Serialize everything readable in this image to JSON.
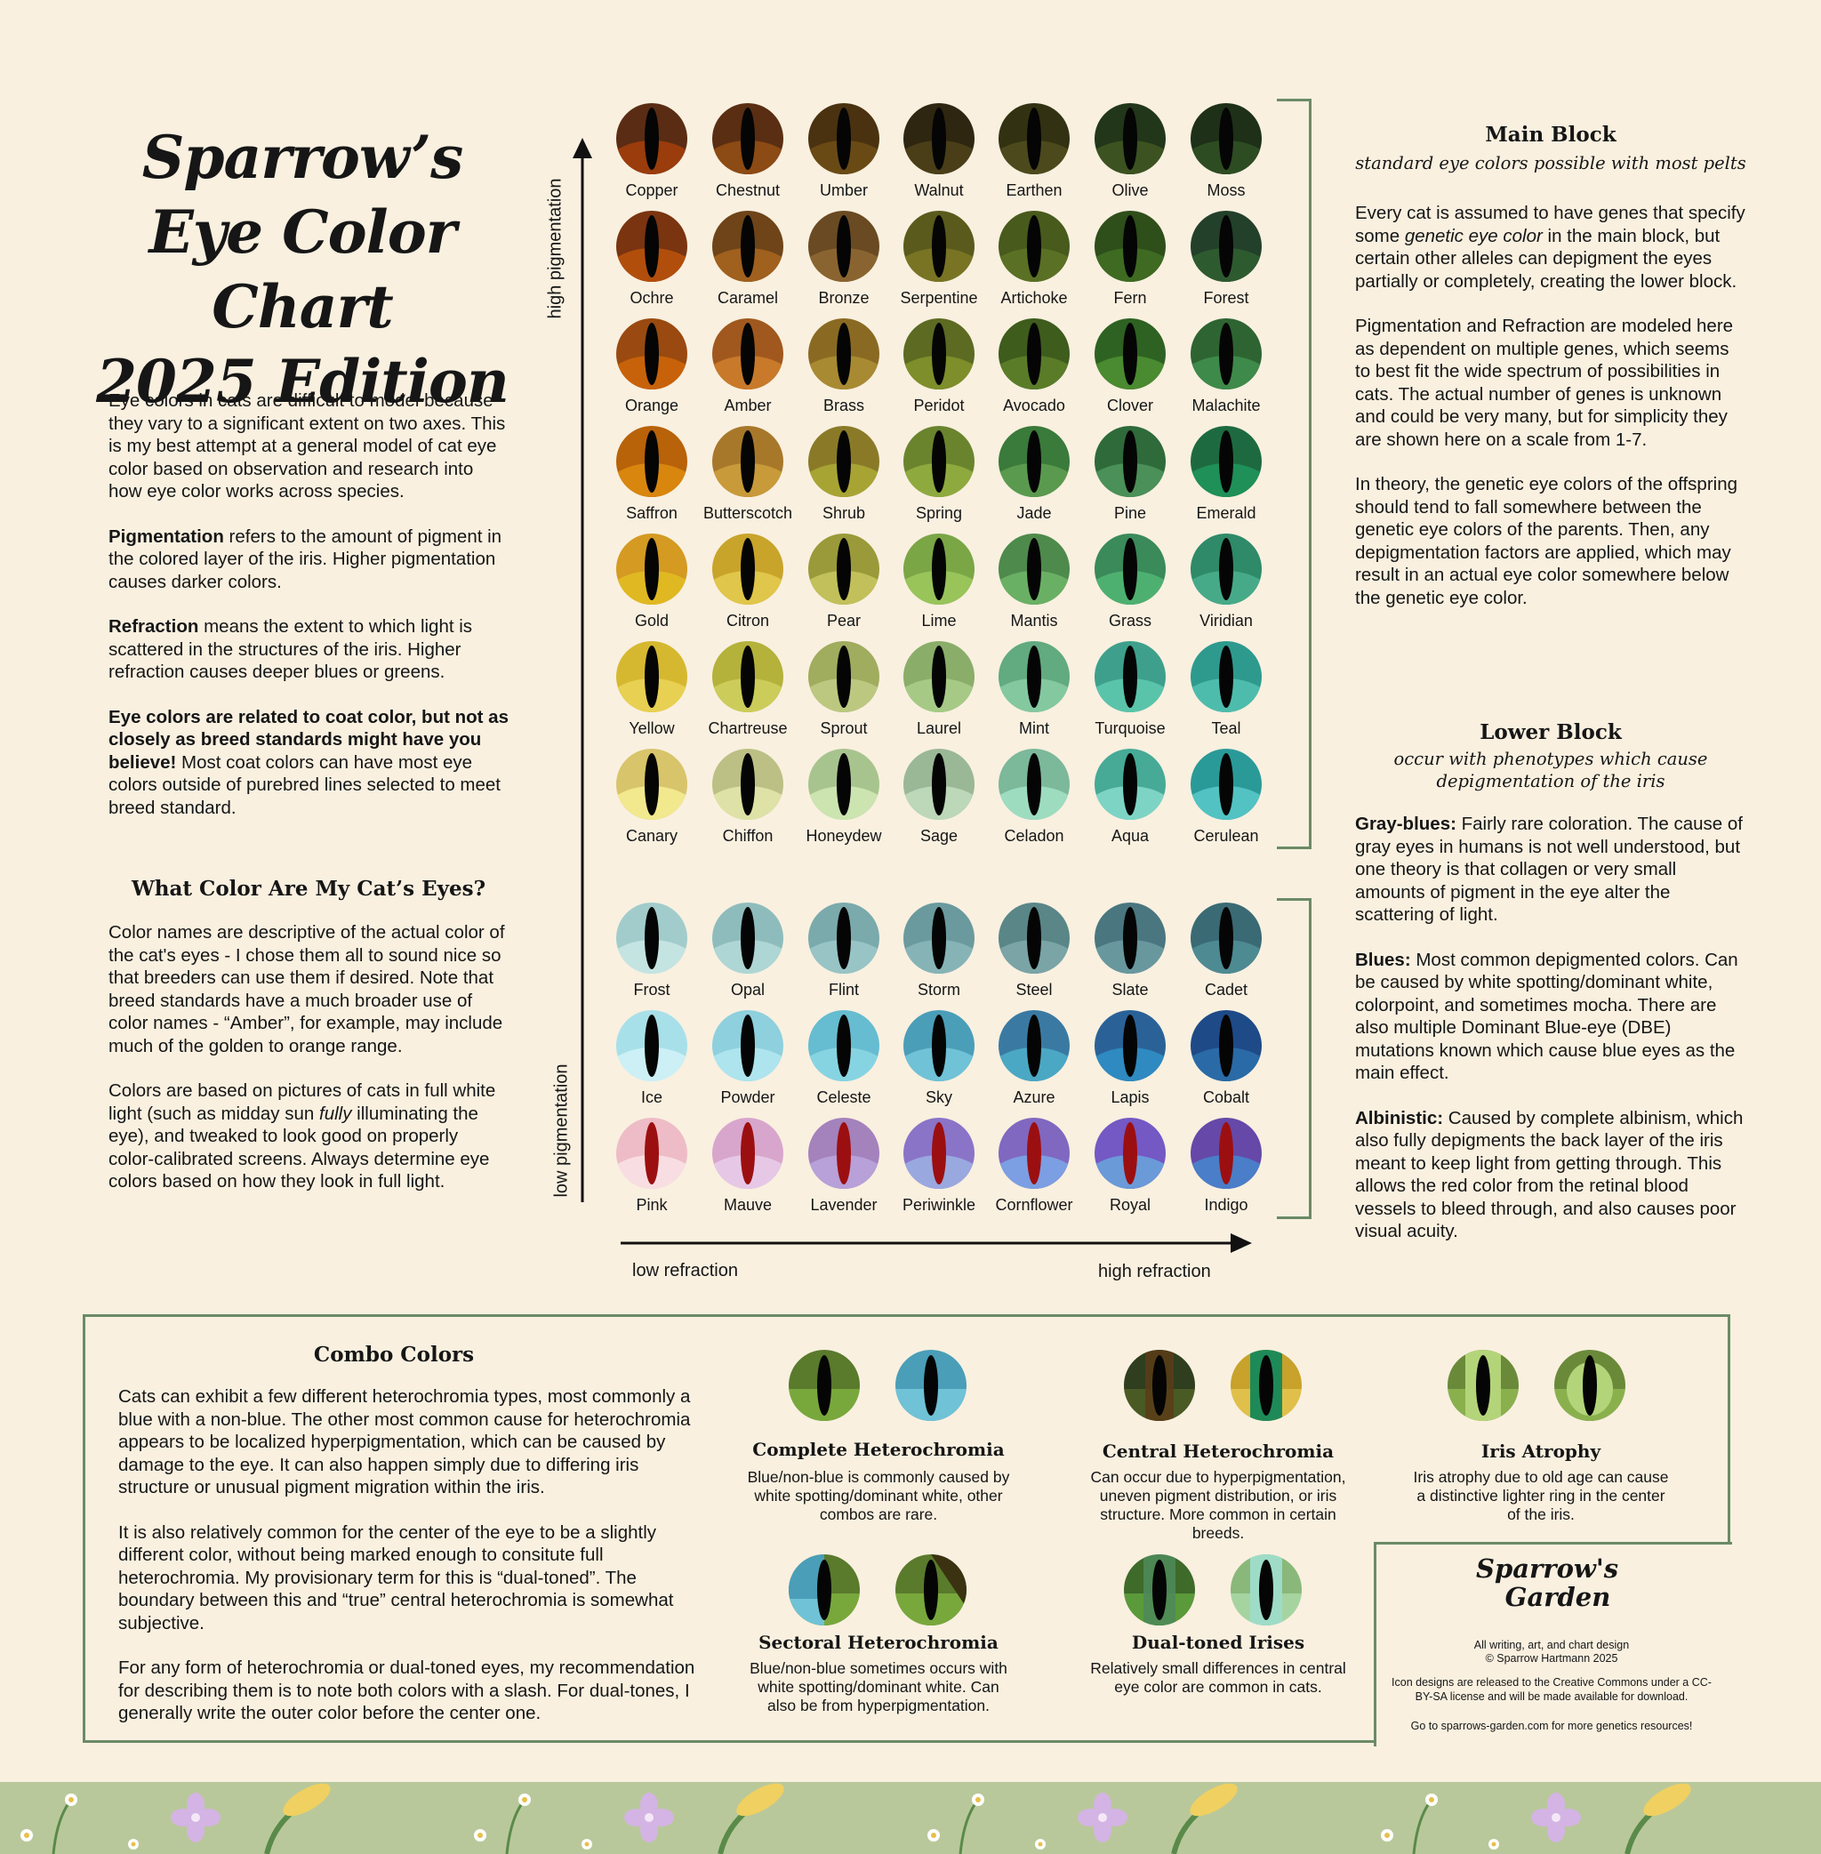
{
  "title": {
    "line1": "Sparrow’s",
    "line2": "Eye Color Chart",
    "line3": "2025 Edition"
  },
  "left_intro": [
    {
      "bold": "",
      "text": "Eye colors in cats are difficult to model because they vary to a significant extent on two axes. This is my best attempt at a general model of cat eye color based on observation and research into how eye color works across species."
    },
    {
      "bold": "Pigmentation",
      "text": " refers to the amount of pigment in the colored layer of the iris. Higher pigmentation causes darker colors."
    },
    {
      "bold": "Refraction",
      "text": " means the extent to which light is scattered in the structures of the iris. Higher refraction causes deeper blues or greens."
    },
    {
      "bold": "Eye colors are related to coat color, but not as closely as breed standards might have you believe!",
      "text": " Most coat colors can have most eye colors outside of purebred lines selected to meet breed standard."
    }
  ],
  "what_color": {
    "heading": "What Color Are My Cat’s Eyes?",
    "p1": "Color names are descriptive of the actual color of the cat's eyes - I chose them all to sound nice so that breeders can use them if desired. Note that breed standards have a much broader use of color names - “Amber”, for example, may include much of the golden to orange range.",
    "p2_a": "Colors are based on pictures of cats in full white light (such as midday sun ",
    "p2_em": "fully",
    "p2_b": " illuminating the eye), and tweaked to look good on properly color-calibrated screens. Always determine eye colors based on how they look in full light."
  },
  "axes": {
    "high_pigmentation": "high pigmentation",
    "low_pigmentation": "low pigmentation",
    "low_refraction": "low refraction",
    "high_refraction": "high refraction"
  },
  "main_block": {
    "heading": "Main Block",
    "subheading": "standard eye colors possible with most pelts",
    "p1_a": "Every cat is assumed to have genes that specify some ",
    "p1_em": "genetic eye color",
    "p1_b": " in the main block, but certain other alleles can depigment the eyes partially or completely, creating the lower block.",
    "p2": "Pigmentation and Refraction are modeled here as dependent on multiple genes, which seems to best fit the wide spectrum of possibilities in cats. The actual number of genes is unknown and could be very many, but for simplicity they are shown here on a scale from 1-7.",
    "p3": "In theory, the genetic eye colors of the offspring should tend to fall somewhere between the genetic eye colors of the parents. Then, any depigmentation factors are applied, which may result in an actual eye color somewhere below the genetic eye color."
  },
  "lower_block": {
    "heading": "Lower Block",
    "subheading": "occur with phenotypes which cause depigmentation of the iris",
    "items": [
      {
        "bold": "Gray-blues:",
        "text": " Fairly rare coloration. The cause of gray eyes in humans is not well understood, but one theory is that collagen or very small amounts of pigment in the eye alter the scattering of light."
      },
      {
        "bold": "Blues:",
        "text": " Most common depigmented colors. Can be caused by white spotting/dominant white, colorpoint, and sometimes mocha. There are also multiple Dominant Blue-eye (DBE) mutations known which cause blue eyes as the main effect."
      },
      {
        "bold": "Albinistic:",
        "text": " Caused by complete albinism, which also fully depigments the back layer of the iris meant to keep light from getting through. This allows the red color from the retinal blood vessels to bleed through, and also causes poor visual acuity."
      }
    ]
  },
  "eyes_main": [
    [
      {
        "name": "Copper",
        "top": "#5a2c14",
        "bottom": "#9a3c0c"
      },
      {
        "name": "Chestnut",
        "top": "#5a2e12",
        "bottom": "#8c4a14"
      },
      {
        "name": "Umber",
        "top": "#4a3210",
        "bottom": "#6a4a14"
      },
      {
        "name": "Walnut",
        "top": "#2e2610",
        "bottom": "#4a3e18"
      },
      {
        "name": "Earthen",
        "top": "#323212",
        "bottom": "#4c4a1c"
      },
      {
        "name": "Olive",
        "top": "#22361a",
        "bottom": "#3c5220"
      },
      {
        "name": "Moss",
        "top": "#1e3018",
        "bottom": "#2e4c22"
      }
    ],
    [
      {
        "name": "Ochre",
        "top": "#7a3410",
        "bottom": "#b24e0c"
      },
      {
        "name": "Caramel",
        "top": "#6e4418",
        "bottom": "#a0601e"
      },
      {
        "name": "Bronze",
        "top": "#6a4a22",
        "bottom": "#8a6430"
      },
      {
        "name": "Serpentine",
        "top": "#5a5a1c",
        "bottom": "#787424"
      },
      {
        "name": "Artichoke",
        "top": "#485a1c",
        "bottom": "#5a7024"
      },
      {
        "name": "Fern",
        "top": "#2e4e1a",
        "bottom": "#3e6a22"
      },
      {
        "name": "Forest",
        "top": "#23402a",
        "bottom": "#2e5a30"
      }
    ],
    [
      {
        "name": "Orange",
        "top": "#9a4a10",
        "bottom": "#c8620a"
      },
      {
        "name": "Amber",
        "top": "#a0581e",
        "bottom": "#c87a2a"
      },
      {
        "name": "Brass",
        "top": "#8a6a22",
        "bottom": "#a88a32"
      },
      {
        "name": "Peridot",
        "top": "#5c6a22",
        "bottom": "#7e8e2a"
      },
      {
        "name": "Avocado",
        "top": "#3e5c1c",
        "bottom": "#5a7c28"
      },
      {
        "name": "Clover",
        "top": "#2e6222",
        "bottom": "#4a8a30"
      },
      {
        "name": "Malachite",
        "top": "#2e6432",
        "bottom": "#3e8a4a"
      }
    ],
    [
      {
        "name": "Saffron",
        "top": "#b8620a",
        "bottom": "#d8860e"
      },
      {
        "name": "Butterscotch",
        "top": "#a8782a",
        "bottom": "#c89a3a"
      },
      {
        "name": "Shrub",
        "top": "#8a7a28",
        "bottom": "#a8a434"
      },
      {
        "name": "Spring",
        "top": "#6a842e",
        "bottom": "#8eaa3e"
      },
      {
        "name": "Jade",
        "top": "#3a7a3a",
        "bottom": "#5a9a4e"
      },
      {
        "name": "Pine",
        "top": "#2e6a3a",
        "bottom": "#4a9058"
      },
      {
        "name": "Emerald",
        "top": "#1e6a40",
        "bottom": "#1e9058"
      }
    ],
    [
      {
        "name": "Gold",
        "top": "#d49a22",
        "bottom": "#e0b822"
      },
      {
        "name": "Citron",
        "top": "#c8a42a",
        "bottom": "#e0c64a"
      },
      {
        "name": "Pear",
        "top": "#9a9a3a",
        "bottom": "#c2c05a"
      },
      {
        "name": "Lime",
        "top": "#7aa646",
        "bottom": "#98c45a"
      },
      {
        "name": "Mantis",
        "top": "#4e8a4c",
        "bottom": "#6ab064"
      },
      {
        "name": "Grass",
        "top": "#3a8a5a",
        "bottom": "#4eb070"
      },
      {
        "name": "Viridian",
        "top": "#2e8a68",
        "bottom": "#46aa88"
      }
    ],
    [
      {
        "name": "Yellow",
        "top": "#d6b830",
        "bottom": "#e8d052"
      },
      {
        "name": "Chartreuse",
        "top": "#b4b23a",
        "bottom": "#cccc5a"
      },
      {
        "name": "Sprout",
        "top": "#a0ac5e",
        "bottom": "#bcc880"
      },
      {
        "name": "Laurel",
        "top": "#8aae6a",
        "bottom": "#a6ca86"
      },
      {
        "name": "Mint",
        "top": "#62aa80",
        "bottom": "#84c8a0"
      },
      {
        "name": "Turquoise",
        "top": "#3ea08c",
        "bottom": "#5ac4aa"
      },
      {
        "name": "Teal",
        "top": "#2e9a8e",
        "bottom": "#4ebcac"
      }
    ],
    [
      {
        "name": "Canary",
        "top": "#d8c46a",
        "bottom": "#f2e88e"
      },
      {
        "name": "Chiffon",
        "top": "#bcc084",
        "bottom": "#dee2a6"
      },
      {
        "name": "Honeydew",
        "top": "#a8c48e",
        "bottom": "#cce4b0"
      },
      {
        "name": "Sage",
        "top": "#9ab896",
        "bottom": "#bcd8b8"
      },
      {
        "name": "Celadon",
        "top": "#7cb89a",
        "bottom": "#9edcc0"
      },
      {
        "name": "Aqua",
        "top": "#46aa96",
        "bottom": "#7ed4c4"
      },
      {
        "name": "Cerulean",
        "top": "#2a9a98",
        "bottom": "#52c2c2"
      }
    ]
  ],
  "eyes_lower": [
    [
      {
        "name": "Frost",
        "top": "#a2cccc",
        "bottom": "#c4e4e2"
      },
      {
        "name": "Opal",
        "top": "#8ebcbc",
        "bottom": "#aed6d4"
      },
      {
        "name": "Flint",
        "top": "#7aaaac",
        "bottom": "#98c4c6"
      },
      {
        "name": "Storm",
        "top": "#6a9a9e",
        "bottom": "#86b4b6"
      },
      {
        "name": "Steel",
        "top": "#5a8688",
        "bottom": "#7aa4a6"
      },
      {
        "name": "Slate",
        "top": "#4a7680",
        "bottom": "#68989e"
      },
      {
        "name": "Cadet",
        "top": "#3a6a74",
        "bottom": "#4e8a92"
      }
    ],
    [
      {
        "name": "Ice",
        "top": "#a8e0ea",
        "bottom": "#ccf0f6"
      },
      {
        "name": "Powder",
        "top": "#8ed0de",
        "bottom": "#aee4ee"
      },
      {
        "name": "Celeste",
        "top": "#66bcd0",
        "bottom": "#86d4e2"
      },
      {
        "name": "Sky",
        "top": "#4a9eb8",
        "bottom": "#70c2d6"
      },
      {
        "name": "Azure",
        "top": "#3a7aa2",
        "bottom": "#4aa8c4"
      },
      {
        "name": "Lapis",
        "top": "#2a6298",
        "bottom": "#2e8ac0"
      },
      {
        "name": "Cobalt",
        "top": "#1e4a88",
        "bottom": "#2a6aa6"
      }
    ],
    [
      {
        "name": "Pink",
        "top": "#eebcc6",
        "bottom": "#f8dee2"
      },
      {
        "name": "Mauve",
        "top": "#d8a6cc",
        "bottom": "#e6c8e6"
      },
      {
        "name": "Lavender",
        "top": "#a482bc",
        "bottom": "#b8a0d8"
      },
      {
        "name": "Periwinkle",
        "top": "#8a74c8",
        "bottom": "#9aa8e0"
      },
      {
        "name": "Cornflower",
        "top": "#8068c0",
        "bottom": "#7c9ee2"
      },
      {
        "name": "Royal",
        "top": "#7458c4",
        "bottom": "#6a9ad8"
      },
      {
        "name": "Indigo",
        "top": "#6648a8",
        "bottom": "#4a7ec8"
      }
    ]
  ],
  "pupil_colors": {
    "normal": "#050505",
    "albino": "#9c0f10"
  },
  "combo": {
    "heading": "Combo Colors",
    "p1": "Cats can exhibit a few different heterochromia types, most commonly a blue with a non-blue. The other most common cause for heterochromia appears to be localized hyperpigmentation, which can be caused by damage to the eye. It can also happen simply due to differing iris structure or unusual pigment migration within the iris.",
    "p2": "It is also relatively common for the center of the eye to be a slightly different color, without being marked enough to consitute full heterochromia. My provisionary term for this is “dual-toned”. The boundary between this and “true” central heterochromia is somewhat subjective.",
    "p3": "For any form of heterochromia or dual-toned eyes, my recommendation for describing them is to note both colors with a slash. For dual-tones, I generally write the outer color before the center one.",
    "types": [
      {
        "title": "Complete Heterochromia",
        "desc": "Blue/non-blue is commonly caused by white spotting/dominant white, other combos are rare."
      },
      {
        "title": "Central Heterochromia",
        "desc": "Can occur due to hyperpigmentation, uneven pigment distribution, or iris structure. More common in certain breeds."
      },
      {
        "title": "Iris Atrophy",
        "desc": "Iris atrophy due to old age can cause a distinctive lighter ring in the center of the iris."
      },
      {
        "title": "Sectoral Heterochromia",
        "desc": "Blue/non-blue sometimes occurs with white spotting/dominant white. Can also be from hyperpigmentation."
      },
      {
        "title": "Dual-toned Irises",
        "desc": "Relatively small differences in central eye color are common in cats."
      }
    ]
  },
  "credits": {
    "logo_line1": "Sparrow's",
    "logo_line2": "Garden",
    "line1": "All writing, art, and chart design",
    "line2": "© Sparrow Hartmann 2025",
    "license": "Icon designs are released to the Creative Commons under a CC-BY-SA license and will be made available for download.",
    "link": "Go to sparrows-garden.com for more genetics resources!"
  }
}
